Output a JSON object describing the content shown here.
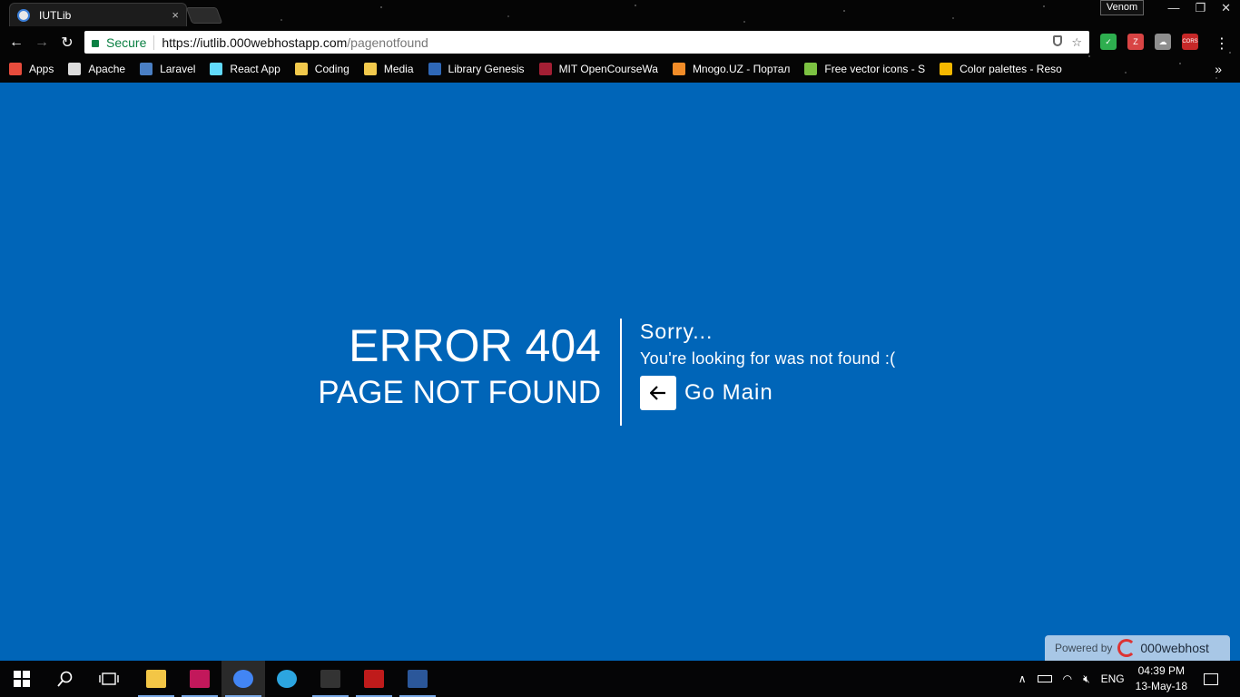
{
  "browser": {
    "tab_title": "IUTLib",
    "tab_close": "×",
    "profile": "Venom",
    "window_controls": [
      "—",
      "❐",
      "✕"
    ],
    "nav": {
      "back": "←",
      "forward": "→",
      "reload": "↻"
    },
    "security_label": "Secure",
    "url_host": "https://iutlib.000webhostapp.com",
    "url_path": "/pagenotfound",
    "star": "☆",
    "menu": "⋮",
    "extensions": [
      {
        "name": "shield-extension-icon",
        "color": "#2eae4f",
        "label": "✓"
      },
      {
        "name": "rtl-extension-icon",
        "color": "#d84444",
        "label": "Z"
      },
      {
        "name": "cloud-extension-icon",
        "color": "#8e8e8e",
        "label": "☁"
      },
      {
        "name": "cors-extension-icon",
        "color": "#c62828",
        "label": "CORS"
      }
    ],
    "bookmarks": [
      {
        "label": "Apps",
        "color": "#e74c3c"
      },
      {
        "label": "Apache",
        "color": "#dddddd"
      },
      {
        "label": "Laravel",
        "color": "#4a7fc4"
      },
      {
        "label": "React App",
        "color": "#61dafb"
      },
      {
        "label": "Coding",
        "color": "#f2c94c"
      },
      {
        "label": "Media",
        "color": "#f2c94c"
      },
      {
        "label": "Library Genesis",
        "color": "#2f68b7"
      },
      {
        "label": "MIT OpenCourseWa",
        "color": "#a31f34"
      },
      {
        "label": "Mnogo.UZ - Портал",
        "color": "#f28c28"
      },
      {
        "label": "Free vector icons - S",
        "color": "#7cc242"
      },
      {
        "label": "Color palettes - Reso",
        "color": "#f5b800"
      }
    ],
    "bookmarks_more": "»"
  },
  "page": {
    "error_code": "ERROR 404",
    "error_title": "PAGE NOT FOUND",
    "sorry": "Sorry...",
    "message": "You're looking for was not found :(",
    "go_main_label": "Go Main",
    "go_main_arrow": "←",
    "powered_by": "Powered by",
    "powered_brand": "000webhost",
    "background_color": "#0065b8"
  },
  "taskbar": {
    "start": "⊞",
    "search": "⚲",
    "task_view": "❐",
    "apps": [
      {
        "name": "file-explorer-icon",
        "color": "#f3c646"
      },
      {
        "name": "save-app-icon",
        "color": "#c2185b"
      },
      {
        "name": "chrome-icon",
        "color": "#4285f4"
      },
      {
        "name": "telegram-icon",
        "color": "#2ca5e0"
      },
      {
        "name": "terminal-icon",
        "color": "#333333"
      },
      {
        "name": "filezilla-icon",
        "color": "#bf1b1b"
      },
      {
        "name": "word-icon",
        "color": "#2b579a"
      }
    ],
    "tray": {
      "language": "ENG",
      "time": "04:39 PM",
      "date": "13-May-18"
    }
  }
}
